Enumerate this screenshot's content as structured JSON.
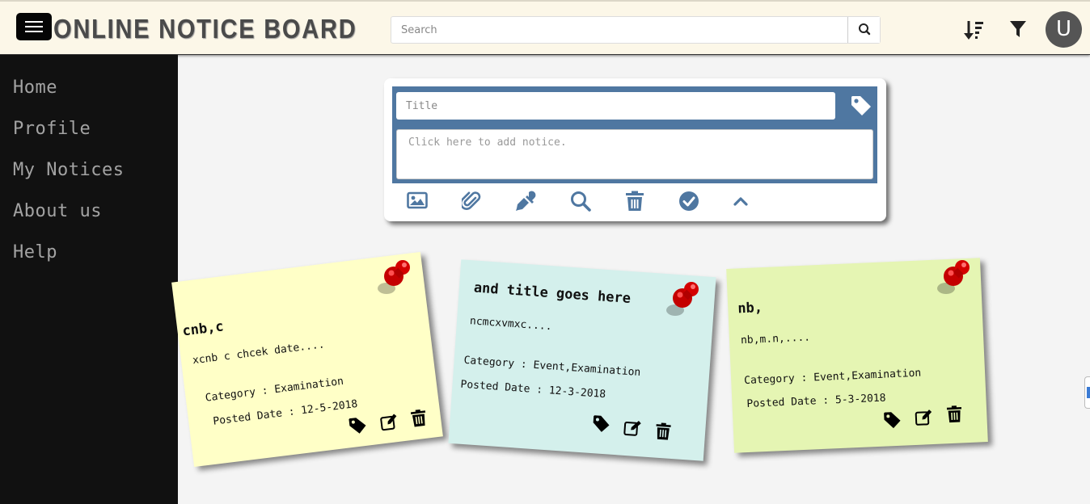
{
  "header": {
    "brand": "ONLINE NOTICE BOARD",
    "search_placeholder": "Search",
    "avatar_letter": "U",
    "icons": [
      "menu-icon",
      "search-icon",
      "sort-icon",
      "filter-icon"
    ]
  },
  "sidebar": {
    "items": [
      {
        "label": "Home"
      },
      {
        "label": "Profile"
      },
      {
        "label": "My Notices"
      },
      {
        "label": "About us"
      },
      {
        "label": "Help"
      }
    ]
  },
  "composer": {
    "title_placeholder": "Title",
    "note_placeholder": "Click here to add notice.",
    "tools": [
      "image-icon",
      "paperclip-icon",
      "eyedropper-icon",
      "search-icon",
      "trash-icon",
      "check-circle-icon",
      "chevron-up-icon"
    ]
  },
  "notes": [
    {
      "title": "cnb,c",
      "preview": "xcnb c chcek date....",
      "category": "Category : Examination",
      "posted": "Posted Date : 12-5-2018",
      "color": "#ffffc7"
    },
    {
      "title": "and title goes here",
      "preview": "ncmcxvmxc....",
      "category": "Category : Event,Examination",
      "posted": "Posted Date : 12-3-2018",
      "color": "#d4f0ec"
    },
    {
      "title": "nb,",
      "preview": "nb,m.n,....",
      "category": "Category : Event,Examination",
      "posted": "Posted Date : 5-3-2018",
      "color": "#e5f5b3"
    }
  ],
  "colors": {
    "composer_blue": "#4f77a1",
    "sidebar_bg": "#111111",
    "header_bg": "#fcf7e8",
    "pin_red": "#d10000"
  }
}
